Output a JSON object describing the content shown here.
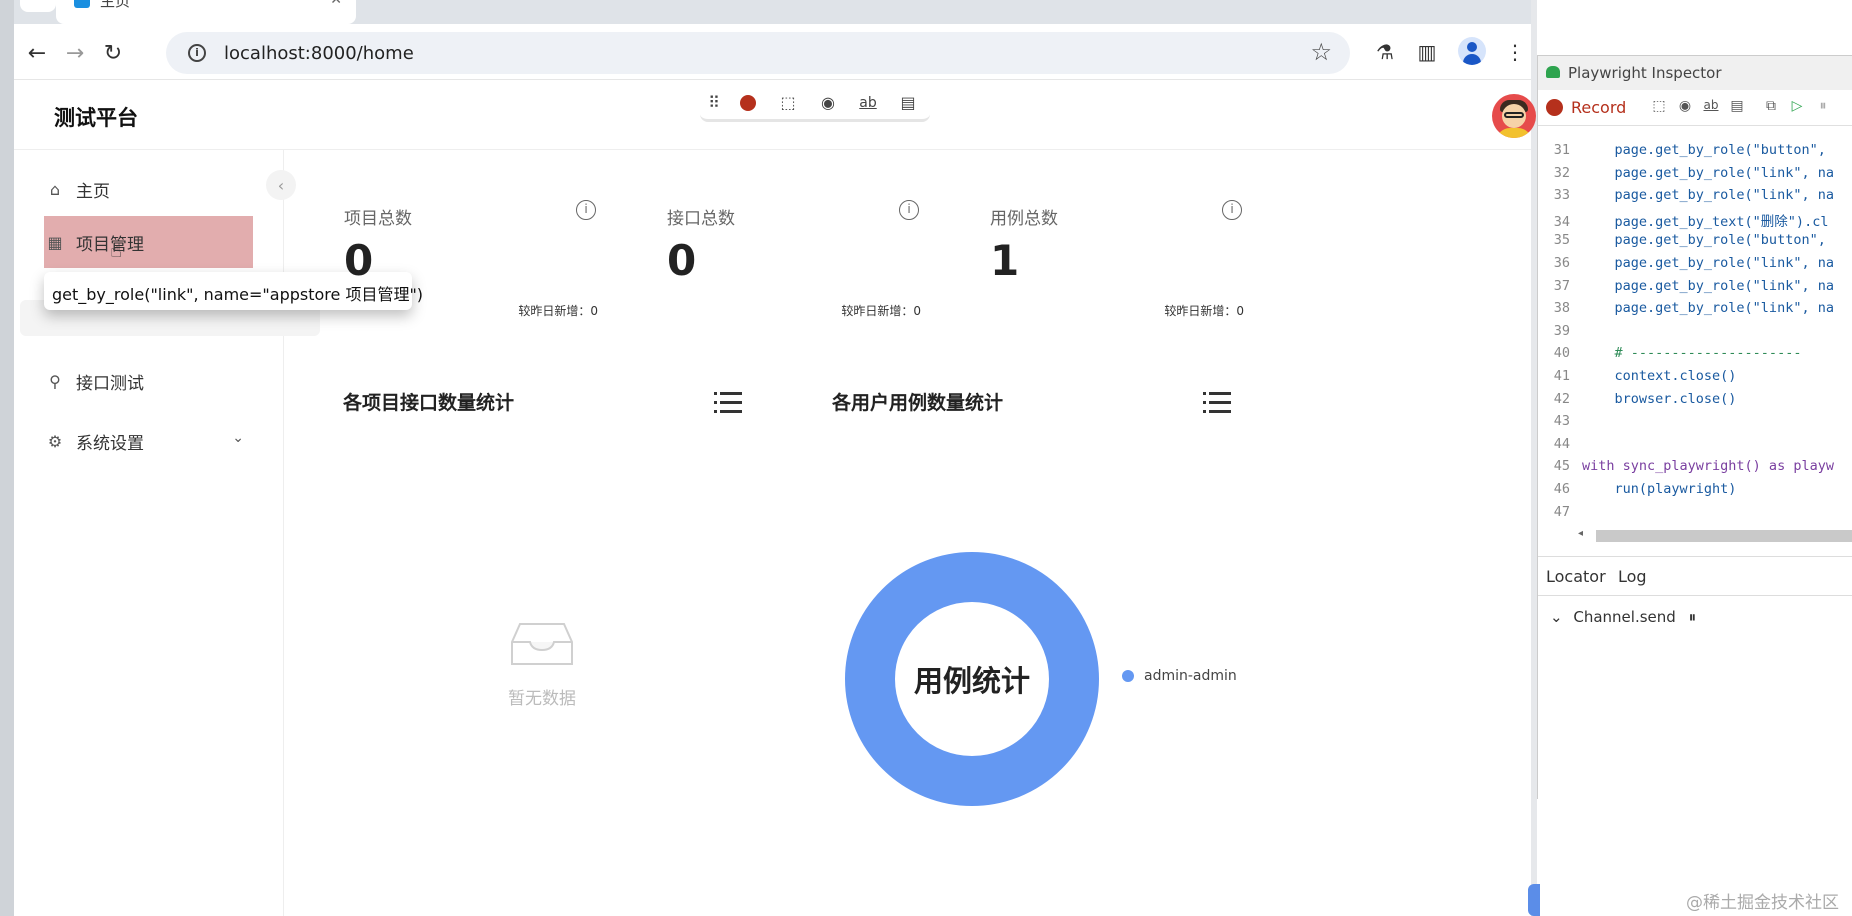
{
  "browser": {
    "tab_title": "主页",
    "url": "localhost:8000/home"
  },
  "app": {
    "brand": "测试平台",
    "sidebar": {
      "items": [
        {
          "label": "主页",
          "icon": "home-icon"
        },
        {
          "label": "项目管理",
          "icon": "appstore-icon"
        },
        {
          "label": "接口测试",
          "icon": "api-icon"
        },
        {
          "label": "系统设置",
          "icon": "gear-icon"
        }
      ]
    },
    "tooltip": "get_by_role(\"link\", name=\"appstore 项目管理\")",
    "stats": [
      {
        "label": "项目总数",
        "value": "0",
        "delta": "较昨日新增：0"
      },
      {
        "label": "接口总数",
        "value": "0",
        "delta": "较昨日新增：0"
      },
      {
        "label": "用例总数",
        "value": "1",
        "delta": "较昨日新增：0"
      }
    ],
    "sections": {
      "left_title": "各项目接口数量统计",
      "right_title": "各用户用例数量统计",
      "empty_text": "暂无数据"
    }
  },
  "chart_data": {
    "type": "pie",
    "title": "用例统计",
    "categories": [
      "admin-admin"
    ],
    "values": [
      1
    ],
    "colors": [
      "#6498f2"
    ],
    "legend_position": "right"
  },
  "inspector": {
    "title": "Playwright Inspector",
    "record_label": "Record",
    "code_lines": [
      {
        "n": "31",
        "t": "    page.get_by_role(\"button\","
      },
      {
        "n": "32",
        "t": "    page.get_by_role(\"link\", na"
      },
      {
        "n": "33",
        "t": "    page.get_by_role(\"link\", na"
      },
      {
        "n": "34",
        "t": "    page.get_by_text(\"删除\").cl"
      },
      {
        "n": "35",
        "t": "    page.get_by_role(\"button\","
      },
      {
        "n": "36",
        "t": "    page.get_by_role(\"link\", na"
      },
      {
        "n": "37",
        "t": "    page.get_by_role(\"link\", na"
      },
      {
        "n": "38",
        "t": "    page.get_by_role(\"link\", na"
      },
      {
        "n": "39",
        "t": ""
      },
      {
        "n": "40",
        "t": "    # ---------------------"
      },
      {
        "n": "41",
        "t": "    context.close()"
      },
      {
        "n": "42",
        "t": "    browser.close()"
      },
      {
        "n": "43",
        "t": ""
      },
      {
        "n": "44",
        "t": ""
      },
      {
        "n": "45",
        "t": "with sync_playwright() as playw"
      },
      {
        "n": "46",
        "t": "    run(playwright)"
      },
      {
        "n": "47",
        "t": ""
      }
    ],
    "tabs": [
      "Locator",
      "Log"
    ],
    "log_entry": "Channel.send"
  },
  "watermark": "@稀土掘金技术社区"
}
